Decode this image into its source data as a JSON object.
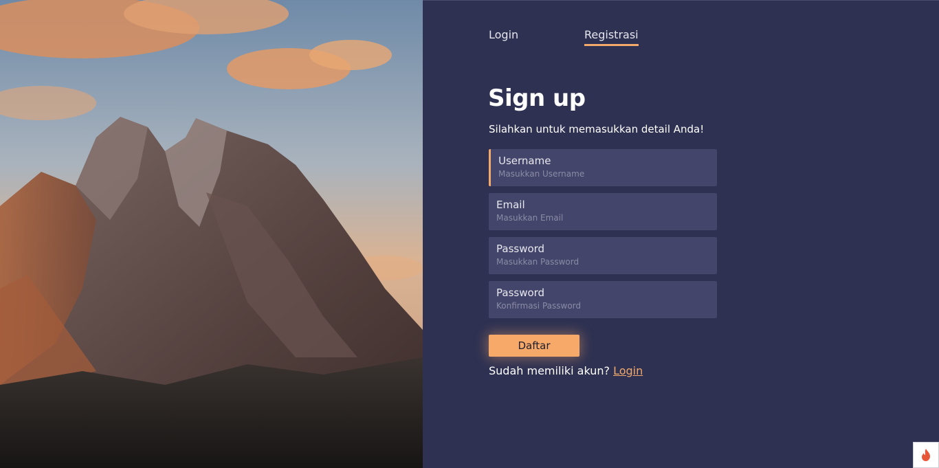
{
  "tabs": [
    {
      "label": "Login",
      "active": false
    },
    {
      "label": "Registrasi",
      "active": true
    }
  ],
  "form": {
    "title": "Sign up",
    "subtitle": "Silahkan untuk memasukkan detail Anda!",
    "fields": [
      {
        "label": "Username",
        "placeholder": "Masukkan Username",
        "value": ""
      },
      {
        "label": "Email",
        "placeholder": "Masukkan Email",
        "value": ""
      },
      {
        "label": "Password",
        "placeholder": "Masukkan Password",
        "value": ""
      },
      {
        "label": "Password",
        "placeholder": "Konfirmasi Password",
        "value": ""
      }
    ],
    "submit_label": "Daftar",
    "footer_text": "Sudah memiliki akun?",
    "footer_link": "Login"
  },
  "hero": {
    "icon": "mountain-landscape"
  },
  "corner_badge": {
    "icon": "flame-icon"
  },
  "colors": {
    "accent": "#f2a96a",
    "panel": "#2e3152",
    "field": "#43456a"
  }
}
